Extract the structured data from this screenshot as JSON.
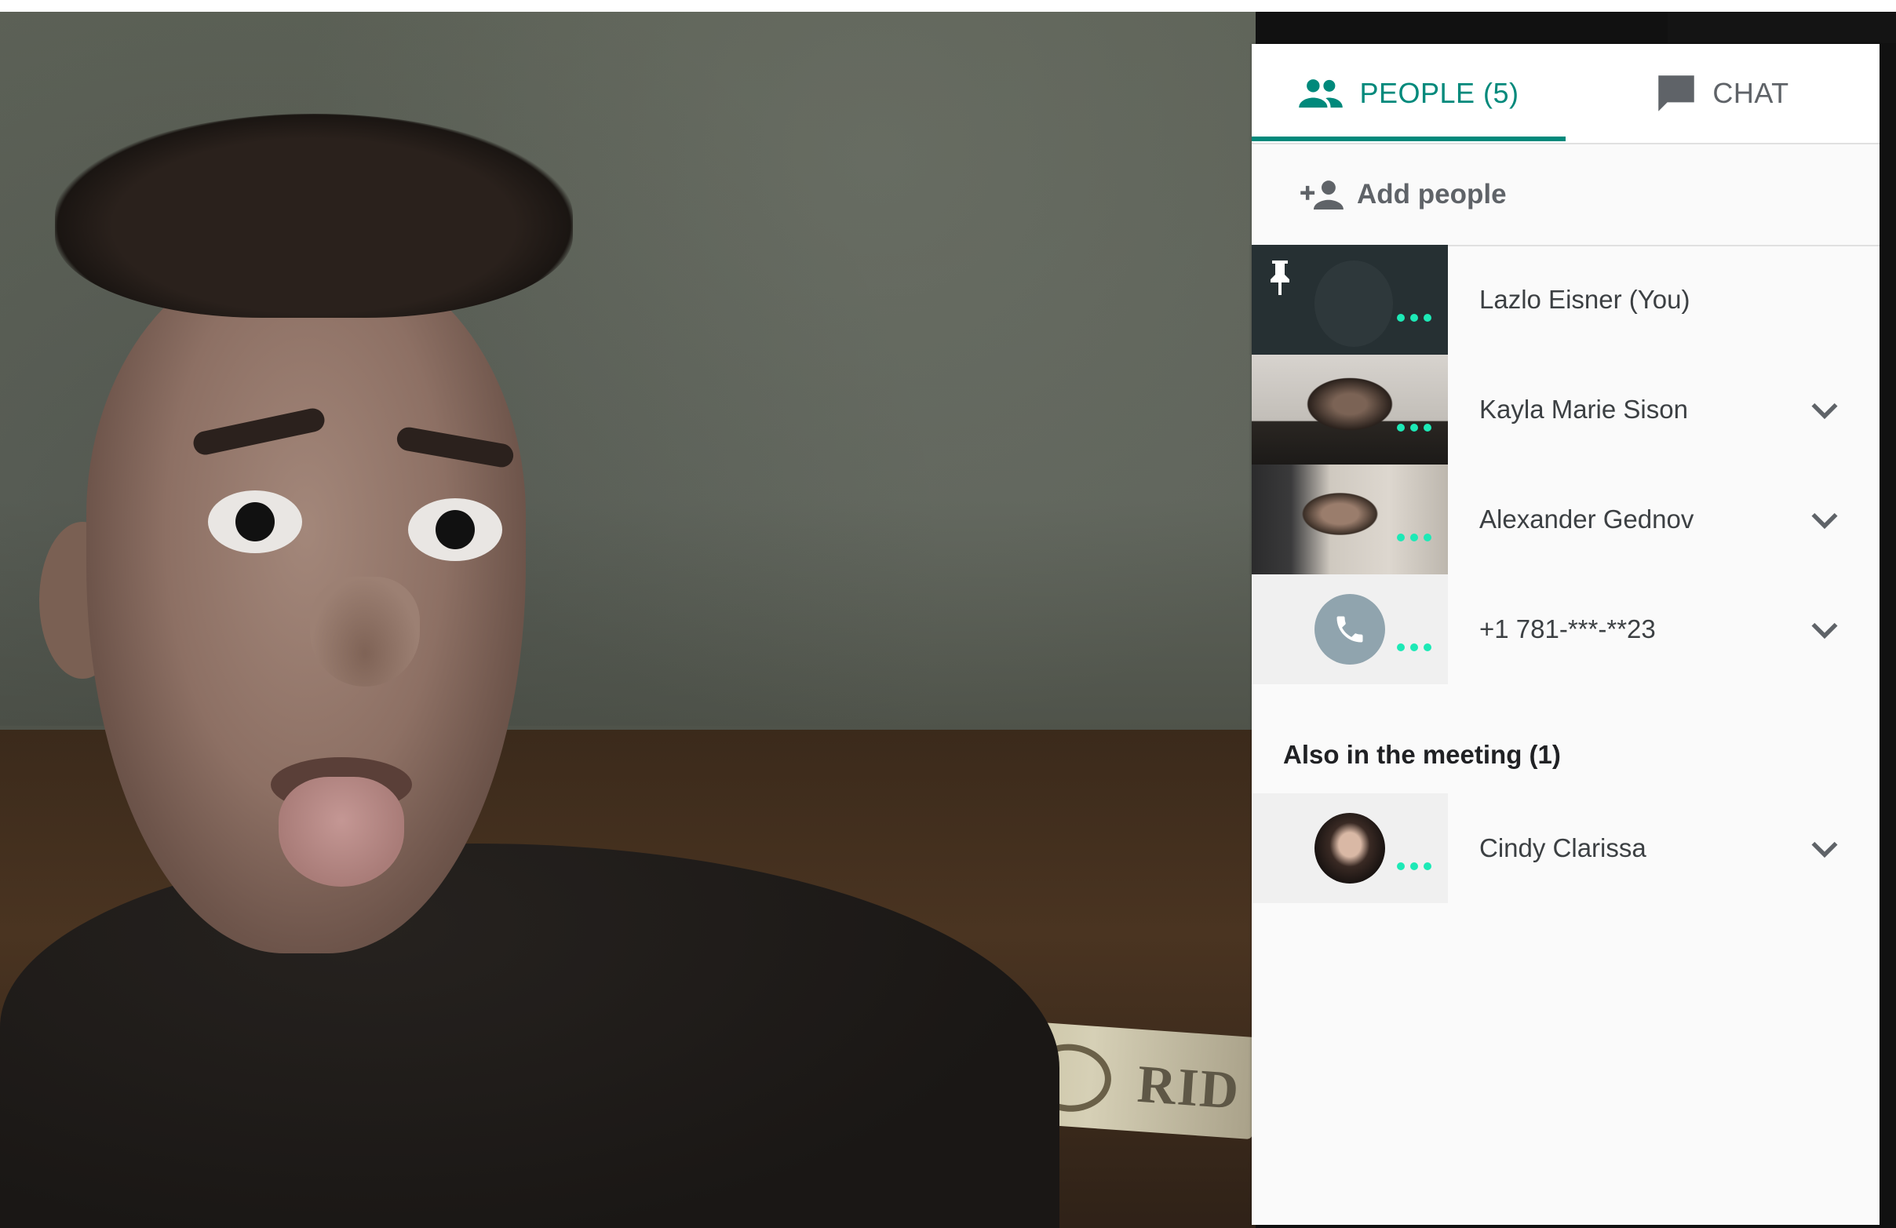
{
  "tabs": [
    {
      "label": "PEOPLE (5)",
      "icon": "people-icon",
      "active": true
    },
    {
      "label": "CHAT",
      "icon": "chat-icon",
      "active": false
    }
  ],
  "add_people": {
    "label": "Add people",
    "icon": "person-add-icon"
  },
  "participants": [
    {
      "name": "Lazlo Eisner (You)",
      "pinned": true,
      "thumb": "video-dark"
    },
    {
      "name": "Kayla Marie Sison",
      "thumb": "video"
    },
    {
      "name": "Alexander Gednov",
      "thumb": "video"
    },
    {
      "name": "+1 781-***-**23",
      "thumb": "phone-icon"
    }
  ],
  "also_in_meeting": {
    "title": "Also in the meeting (1)",
    "participants": [
      {
        "name": "Cindy Clarissa",
        "thumb": "avatar"
      }
    ]
  },
  "feed": {
    "scarf_text": "RID"
  },
  "colors": {
    "accent": "#00897b",
    "activity_dots": "#1de9b6",
    "muted_text": "#5f6368",
    "phone_avatar_bg": "#90a4ae"
  }
}
